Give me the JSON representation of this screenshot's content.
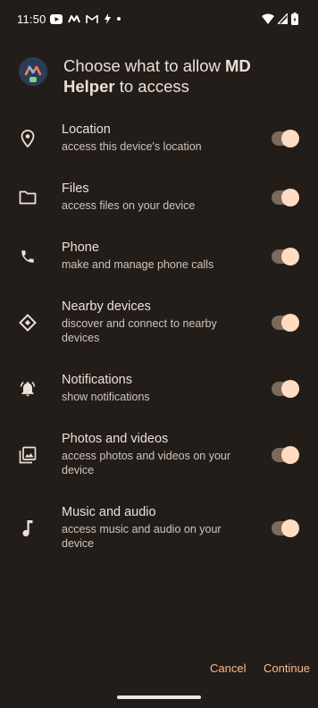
{
  "status_bar": {
    "time": "11:50",
    "left_icons": [
      "youtube-icon",
      "app-m-icon",
      "gmail-icon",
      "flash-icon",
      "dot-icon"
    ],
    "right_icons": [
      "wifi-icon",
      "signal-icon",
      "battery-charging-icon"
    ]
  },
  "header": {
    "title_prefix": "Choose what to allow ",
    "app_name": "MD Helper",
    "title_suffix": " to access"
  },
  "permissions": [
    {
      "title": "Location",
      "desc": "access this device's location",
      "icon": "location-icon",
      "enabled": true
    },
    {
      "title": "Files",
      "desc": "access files on your device",
      "icon": "folder-icon",
      "enabled": true
    },
    {
      "title": "Phone",
      "desc": "make and manage phone calls",
      "icon": "phone-icon",
      "enabled": true
    },
    {
      "title": "Nearby devices",
      "desc": "discover and connect to nearby devices",
      "icon": "nearby-devices-icon",
      "enabled": true
    },
    {
      "title": "Notifications",
      "desc": "show notifications",
      "icon": "notification-bell-icon",
      "enabled": true
    },
    {
      "title": "Photos and videos",
      "desc": "access photos and videos on your device",
      "icon": "photo-library-icon",
      "enabled": true
    },
    {
      "title": "Music and audio",
      "desc": "access music and audio on your device",
      "icon": "music-note-icon",
      "enabled": true
    }
  ],
  "footer": {
    "cancel_label": "Cancel",
    "continue_label": "Continue"
  },
  "colors": {
    "background": "#231d19",
    "accent": "#ffb985",
    "toggle_track": "#7a6a5d",
    "toggle_knob": "#ffdcc1"
  }
}
